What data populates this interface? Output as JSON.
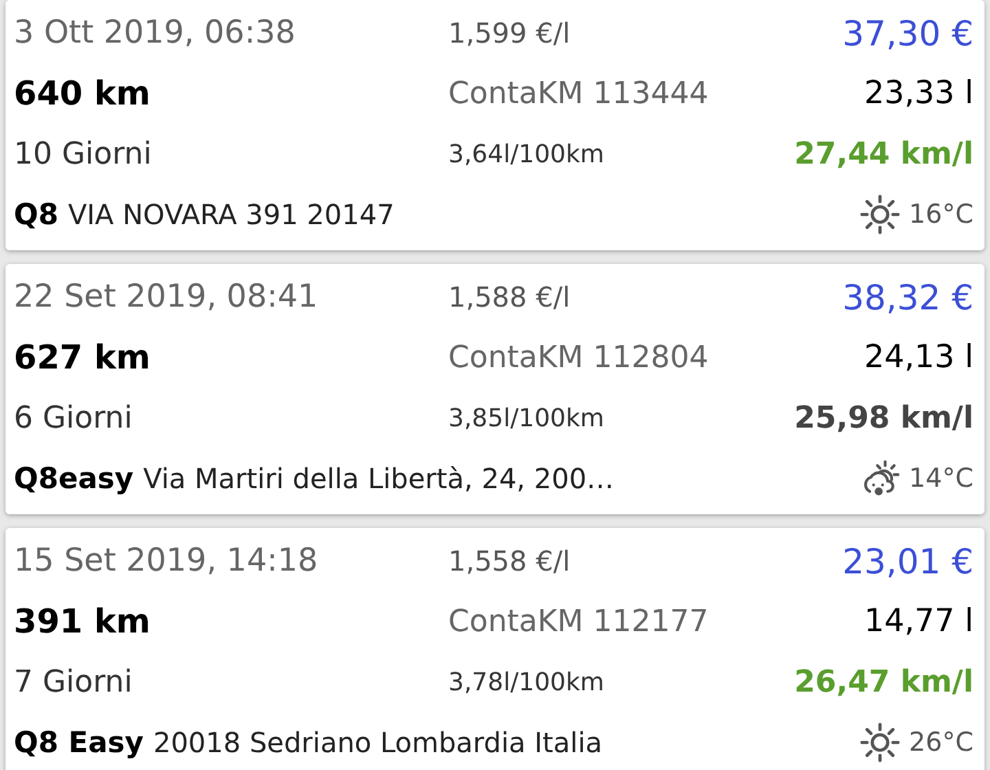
{
  "entries": [
    {
      "date": "3 Ott 2019, 06:38",
      "price_per_liter": "1,599 €/l",
      "total": "37,30 €",
      "distance": "640 km",
      "odometer": "ContaKM 113444",
      "liters": "23,33 l",
      "interval": "10 Giorni",
      "consumption": "3,64l/100km",
      "efficiency": "27,44 km/l",
      "efficiency_good": true,
      "station": "Q8",
      "address": "VIA NOVARA 391 20147",
      "weather": {
        "kind": "sunny",
        "temperature": "16°C"
      }
    },
    {
      "date": "22 Set 2019, 08:41",
      "price_per_liter": "1,588 €/l",
      "total": "38,32 €",
      "distance": "627 km",
      "odometer": "ContaKM 112804",
      "liters": "24,13 l",
      "interval": "6 Giorni",
      "consumption": "3,85l/100km",
      "efficiency": "25,98 km/l",
      "efficiency_good": false,
      "station": "Q8easy",
      "address": "Via Martiri della Libertà, 24, 200…",
      "weather": {
        "kind": "showers",
        "temperature": "14°C"
      }
    },
    {
      "date": "15 Set 2019, 14:18",
      "price_per_liter": "1,558 €/l",
      "total": "23,01 €",
      "distance": "391 km",
      "odometer": "ContaKM 112177",
      "liters": "14,77 l",
      "interval": "7 Giorni",
      "consumption": "3,78l/100km",
      "efficiency": "26,47 km/l",
      "efficiency_good": true,
      "station": "Q8 Easy",
      "address": "20018 Sedriano Lombardia Italia",
      "weather": {
        "kind": "sunny",
        "temperature": "26°C"
      }
    }
  ]
}
